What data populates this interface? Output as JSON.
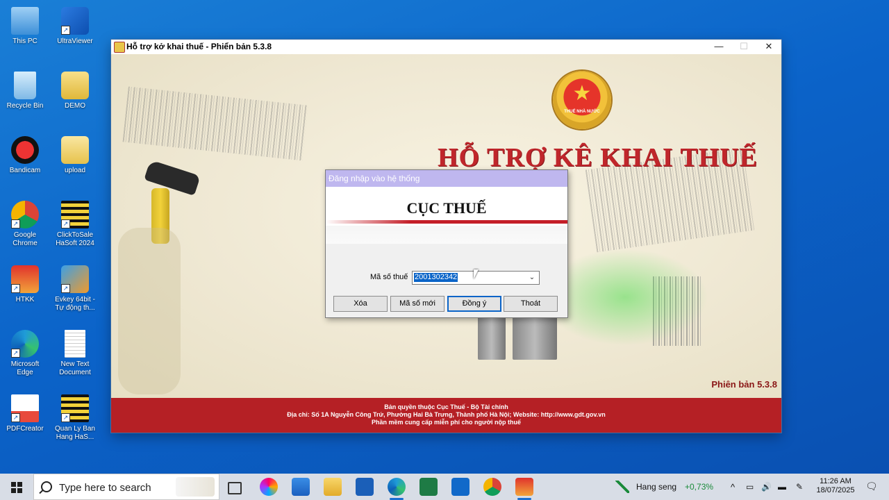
{
  "desktop": {
    "icons": [
      {
        "label": "This PC"
      },
      {
        "label": "UltraViewer"
      },
      {
        "label": "Recycle Bin"
      },
      {
        "label": "DEMO"
      },
      {
        "label": "Bandicam"
      },
      {
        "label": "upload"
      },
      {
        "label": "Google Chrome"
      },
      {
        "label": "ClickToSale HaSoft 2024"
      },
      {
        "label": "HTKK"
      },
      {
        "label": "Evkey 64bit - Tự động th..."
      },
      {
        "label": "Microsoft Edge"
      },
      {
        "label": "New Text Document"
      },
      {
        "label": "PDFCreator"
      },
      {
        "label": "Quan Ly Ban Hang HaS..."
      }
    ]
  },
  "window": {
    "title": "Hỗ trợ kở khai thuế -  Phiển bản 5.3.8",
    "minimize": "—",
    "maximize": "☐",
    "close": "✕",
    "emblem_label": "THUẾ NHÀ NƯỚC",
    "app_heading": "HỖ TRỢ KÊ KHAI THUẾ",
    "version": "Phiên bản 5.3.8",
    "footer": {
      "line1": "Bản quyền thuộc Cục Thuế - Bộ Tài chính",
      "line2": "Địa chỉ: Số 1A Nguyễn Công Trứ, Phường Hai Bà Trưng, Thành phố Hà Nội; Website: http://www.gdt.gov.vn",
      "line3": "Phần mềm cung cấp miễn phí cho người nộp thuế"
    }
  },
  "dialog": {
    "title": "Đăng nhập vào hệ thống",
    "heading": "CỤC THUẾ",
    "tax_code_label": "Mã số thuế",
    "tax_code_value": "2001302342",
    "buttons": {
      "delete": "Xóa",
      "new_code": "Mã số mới",
      "ok": "Đồng ý",
      "exit": "Thoát"
    }
  },
  "taskbar": {
    "search_placeholder": "Type here to search",
    "stock_name": "Hang seng",
    "stock_change": "+0,73%",
    "time": "11:26 AM",
    "date": "18/07/2025",
    "colors": {
      "accent": "#1a6fd0",
      "stock_up": "#1a8a3a"
    }
  }
}
